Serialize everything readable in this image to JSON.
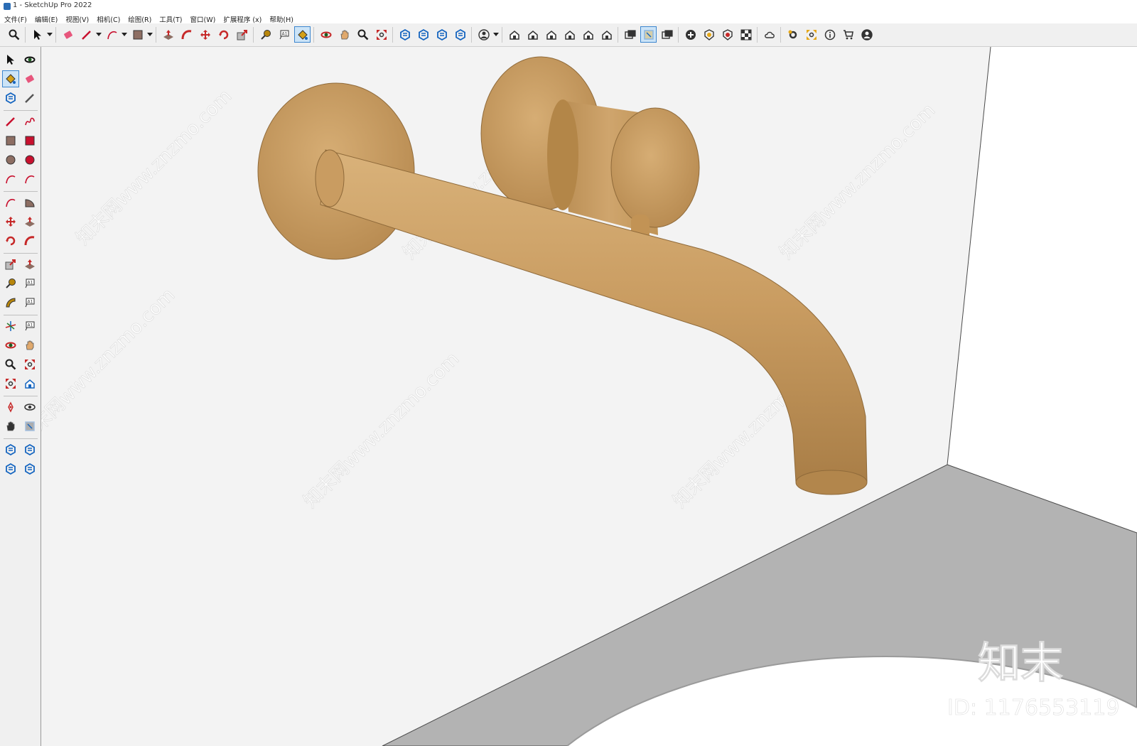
{
  "window": {
    "title": "1 - SketchUp Pro 2022"
  },
  "menu": {
    "items": [
      "文件(F)",
      "编辑(E)",
      "视图(V)",
      "相机(C)",
      "绘图(R)",
      "工具(T)",
      "窗口(W)",
      "扩展程序 (x)",
      "帮助(H)"
    ]
  },
  "toolbar": {
    "items": [
      {
        "name": "zoom-icon",
        "color": "#1f1f1f"
      },
      {
        "name": "select-icon",
        "color": "#111111",
        "dropdown": true
      },
      {
        "name": "eraser-icon",
        "color": "#e7567c"
      },
      {
        "name": "pencil-icon",
        "color": "#c8102e",
        "dropdown": true
      },
      {
        "name": "arc-icon",
        "color": "#c8102e",
        "dropdown": true
      },
      {
        "name": "rectangle-icon",
        "color": "#8d6e63",
        "dropdown": true
      },
      {
        "name": "push-pull-icon",
        "color": "#c62828"
      },
      {
        "name": "follow-me-icon",
        "color": "#c62828"
      },
      {
        "name": "move-icon",
        "color": "#c62828"
      },
      {
        "name": "rotate-icon",
        "color": "#c62828"
      },
      {
        "name": "scale-icon",
        "color": "#c62828"
      },
      {
        "name": "tape-measure-icon",
        "color": "#b8860b"
      },
      {
        "name": "text-icon",
        "color": "#333333"
      },
      {
        "name": "paint-bucket-icon",
        "color": "#d4a017",
        "active": true
      },
      {
        "name": "orbit-icon",
        "color": "#c62828"
      },
      {
        "name": "pan-icon",
        "color": "#e0a96d"
      },
      {
        "name": "zoom-tool-icon",
        "color": "#1f1f1f"
      },
      {
        "name": "zoom-extents-icon",
        "color": "#c62828"
      },
      {
        "name": "warehouse-icon",
        "color": "#1565c0"
      },
      {
        "name": "extension-warehouse-icon",
        "color": "#1565c0"
      },
      {
        "name": "layout-icon",
        "color": "#1565c0"
      },
      {
        "name": "send-to-layout-icon",
        "color": "#1565c0"
      },
      {
        "name": "account-icon",
        "color": "#333333",
        "dropdown": true
      },
      {
        "name": "iso-view-icon",
        "color": "#333333"
      },
      {
        "name": "top-view-icon",
        "color": "#333333"
      },
      {
        "name": "front-view-icon",
        "color": "#333333"
      },
      {
        "name": "right-view-icon",
        "color": "#333333"
      },
      {
        "name": "back-view-icon",
        "color": "#333333"
      },
      {
        "name": "left-view-icon",
        "color": "#333333"
      },
      {
        "name": "solid-tools-icon",
        "color": "#333333"
      },
      {
        "name": "section-plane-icon",
        "color": "#e6a817",
        "active": true
      },
      {
        "name": "scenes-icon",
        "color": "#333333"
      },
      {
        "name": "add-location-icon",
        "color": "#333333"
      },
      {
        "name": "shadows-icon",
        "color": "#e6a817"
      },
      {
        "name": "fog-icon",
        "color": "#c62828"
      },
      {
        "name": "materials-icon",
        "color": "#333333"
      },
      {
        "name": "cloud-icon",
        "color": "#333333"
      },
      {
        "name": "settings-icon",
        "color": "#e6a817"
      },
      {
        "name": "windows-icon",
        "color": "#e6a817"
      },
      {
        "name": "info-icon",
        "color": "#333333"
      },
      {
        "name": "cart-icon",
        "color": "#333333"
      },
      {
        "name": "user-icon",
        "color": "#333333"
      }
    ]
  },
  "left_toolbar": {
    "items": [
      {
        "name": "select-icon",
        "color": "#111111"
      },
      {
        "name": "orbit-small-icon",
        "color": "#111111"
      },
      {
        "name": "paint-bucket-icon",
        "color": "#d4a017",
        "active": true
      },
      {
        "name": "eraser-icon",
        "color": "#e7567c"
      },
      {
        "name": "component-icon",
        "color": "#1565c0"
      },
      {
        "name": "pencil-tag-icon",
        "color": "#555555"
      },
      {
        "name": "line-icon",
        "color": "#c8102e"
      },
      {
        "name": "freehand-icon",
        "color": "#c8102e"
      },
      {
        "name": "rectangle-icon",
        "color": "#8d6e63"
      },
      {
        "name": "rotated-rectangle-icon",
        "color": "#c8102e"
      },
      {
        "name": "circle-icon",
        "color": "#8d6e63"
      },
      {
        "name": "polygon-icon",
        "color": "#c8102e"
      },
      {
        "name": "arc-icon",
        "color": "#c8102e"
      },
      {
        "name": "two-point-arc-icon",
        "color": "#c8102e"
      },
      {
        "name": "three-point-arc-icon",
        "color": "#c8102e"
      },
      {
        "name": "pie-icon",
        "color": "#8d6e63"
      },
      {
        "name": "move-icon",
        "color": "#c62828"
      },
      {
        "name": "push-pull-icon",
        "color": "#c62828"
      },
      {
        "name": "rotate-icon",
        "color": "#c62828"
      },
      {
        "name": "follow-me-icon",
        "color": "#c62828"
      },
      {
        "name": "scale-icon",
        "color": "#c62828"
      },
      {
        "name": "offset-icon",
        "color": "#c62828"
      },
      {
        "name": "tape-measure-icon",
        "color": "#b8860b"
      },
      {
        "name": "dimension-icon",
        "color": "#333333"
      },
      {
        "name": "protractor-icon",
        "color": "#b8860b"
      },
      {
        "name": "text-icon",
        "color": "#333333"
      },
      {
        "name": "axes-icon",
        "color": "#c62828"
      },
      {
        "name": "3d-text-icon",
        "color": "#333333"
      },
      {
        "name": "orbit-icon",
        "color": "#c62828"
      },
      {
        "name": "pan-icon",
        "color": "#e0a96d"
      },
      {
        "name": "zoom-icon",
        "color": "#1f1f1f"
      },
      {
        "name": "zoom-window-icon",
        "color": "#c62828"
      },
      {
        "name": "zoom-extents-icon",
        "color": "#c62828"
      },
      {
        "name": "previous-view-icon",
        "color": "#1565c0"
      },
      {
        "name": "position-camera-icon",
        "color": "#c62828"
      },
      {
        "name": "look-around-icon",
        "color": "#333333"
      },
      {
        "name": "walk-icon",
        "color": "#333333"
      },
      {
        "name": "section-plane-icon",
        "color": "#333333"
      },
      {
        "name": "warehouse-icon",
        "color": "#1565c0"
      },
      {
        "name": "extension-warehouse-icon",
        "color": "#1565c0"
      },
      {
        "name": "layout-icon",
        "color": "#1565c0"
      },
      {
        "name": "send-to-layout-icon",
        "color": "#1565c0"
      }
    ]
  },
  "viewport": {
    "watermark_text": "知末网www.znzmo.com",
    "brand_mark": "知末",
    "id_label": "ID: 1176553119",
    "colors": {
      "wall": "#f3f3f3",
      "side_wall": "#ffffff",
      "floor": "#b3b3b3",
      "basin": "#ffffff",
      "brass": "#c89a5e"
    }
  }
}
